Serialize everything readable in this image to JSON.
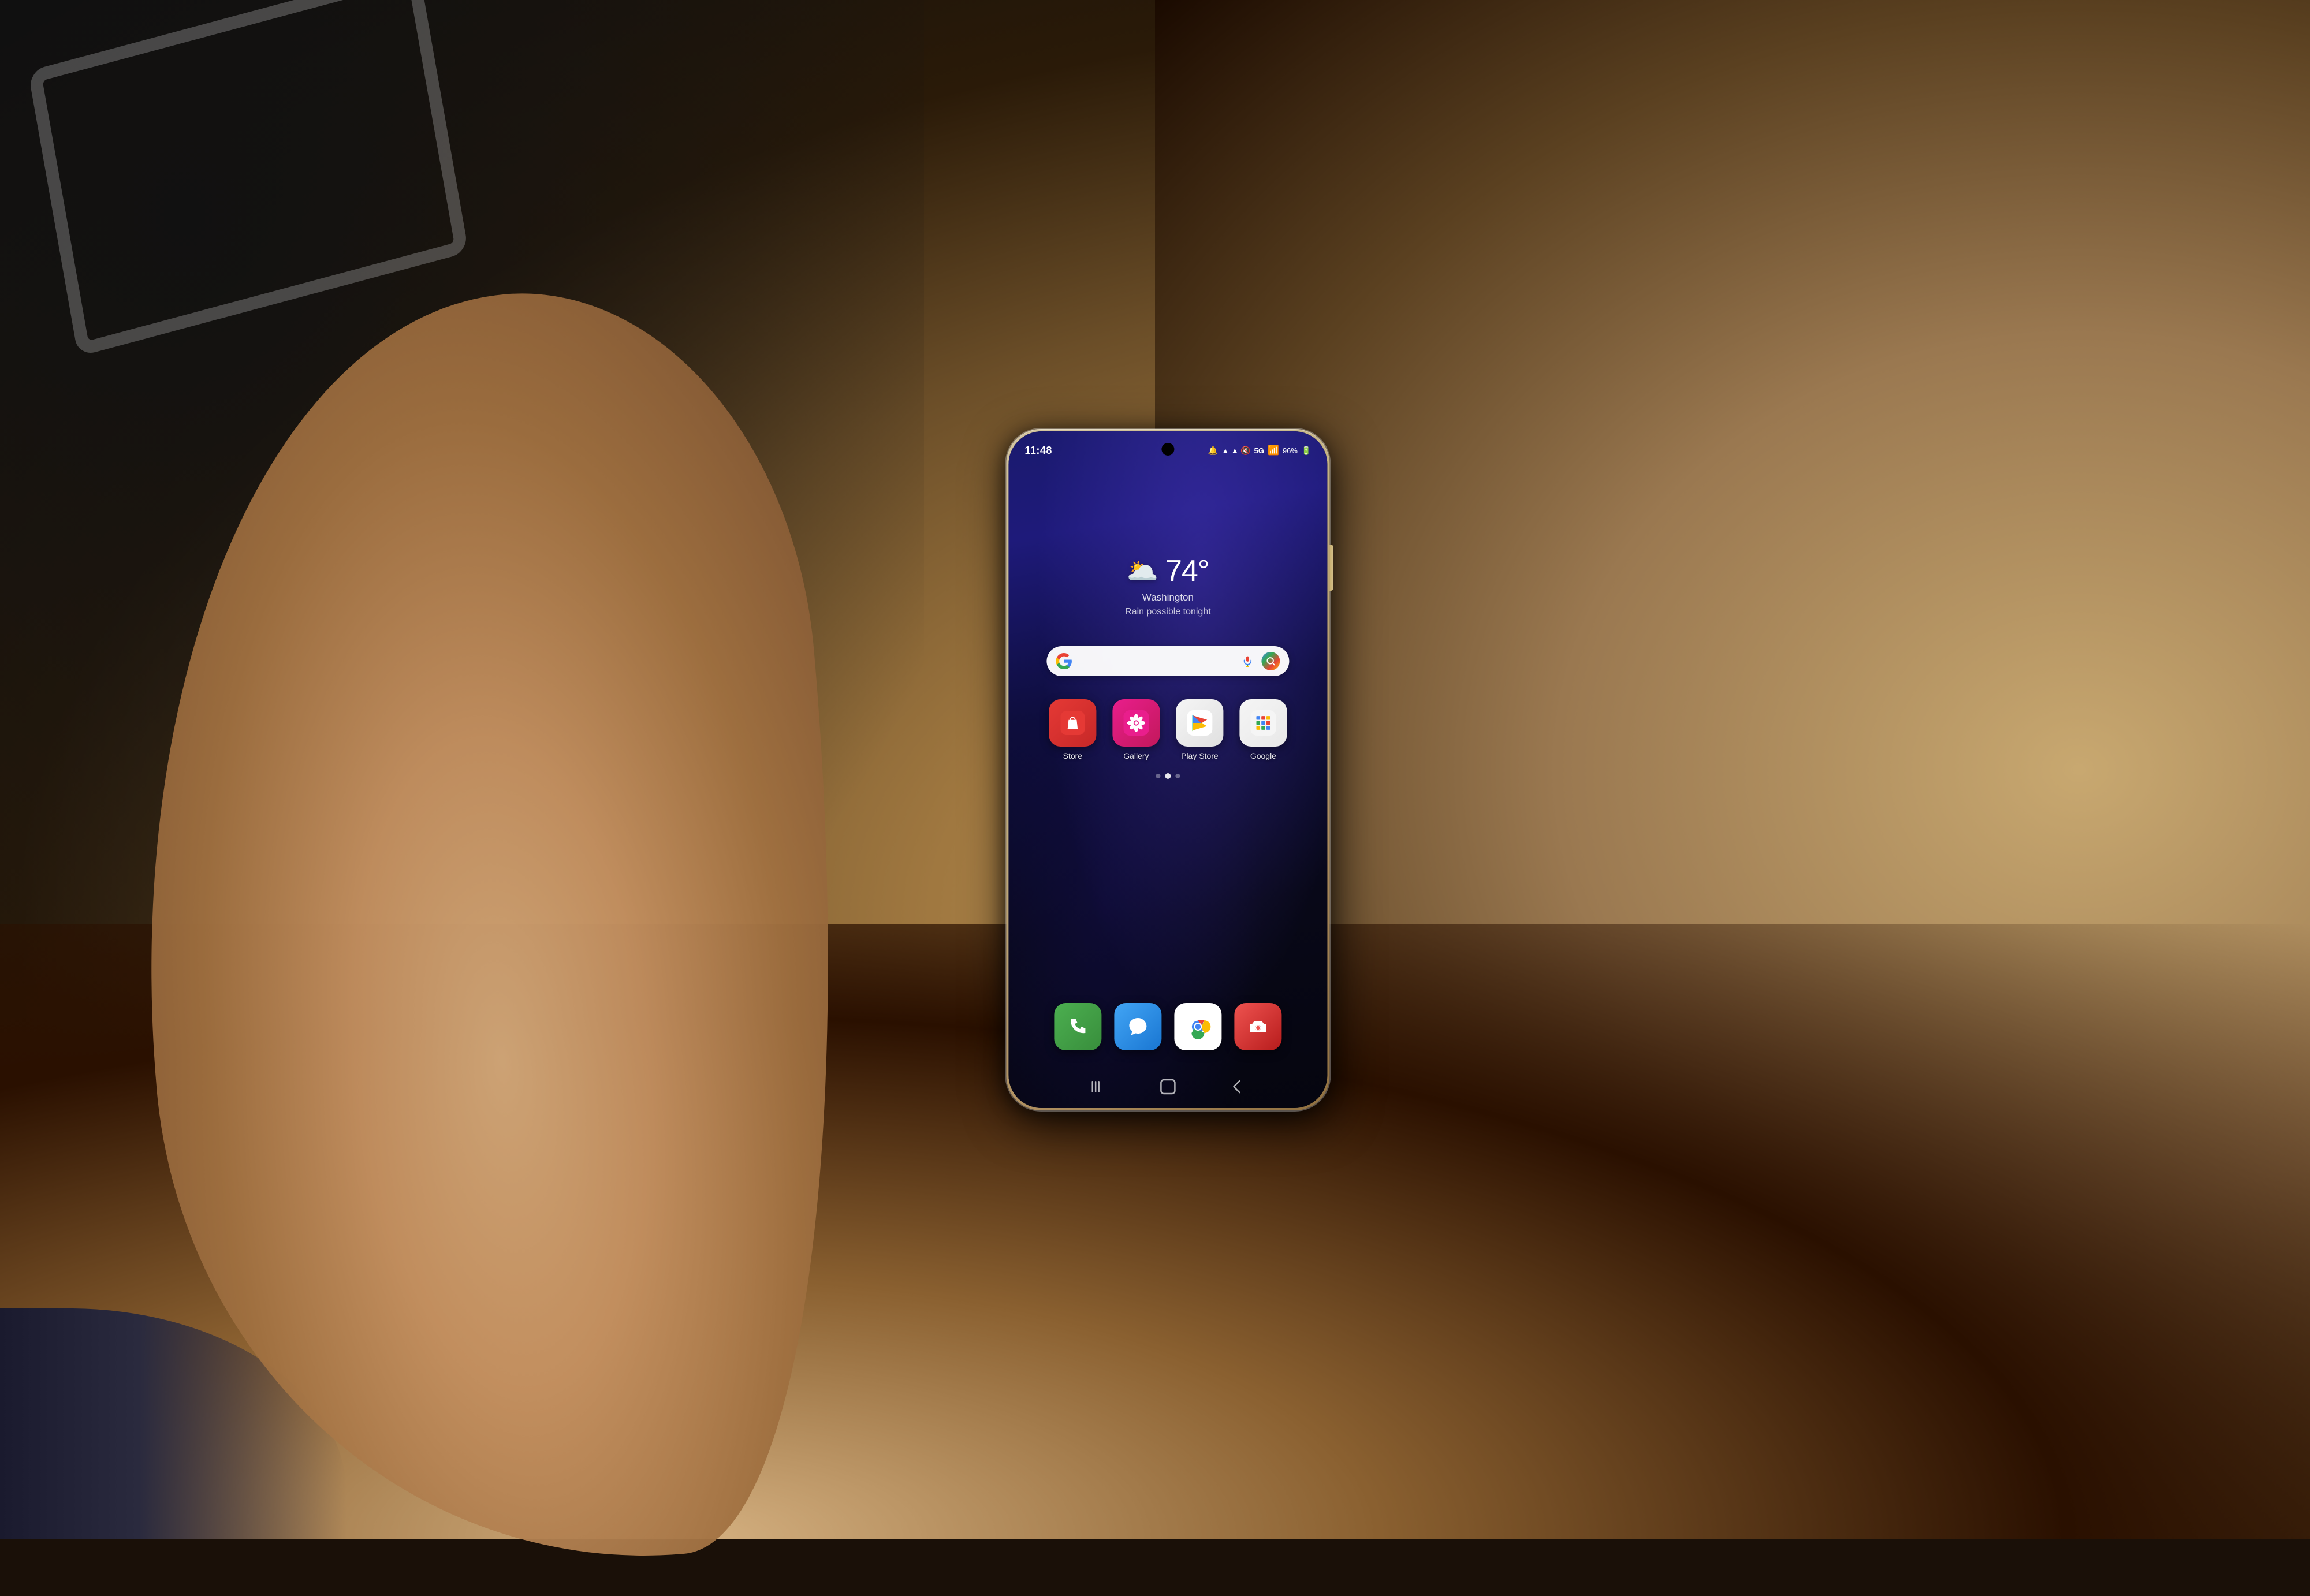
{
  "background": {
    "primary_color": "#1a1008",
    "accent_color": "#c8a96e"
  },
  "phone": {
    "frame_color": "#c8b880",
    "screen_bg_top": "#1a1a6e",
    "screen_bg_bottom": "#05050f"
  },
  "status_bar": {
    "time": "11:48",
    "icons": "🔔 ▲ ▴ 📶",
    "signal": "5G",
    "battery": "96%",
    "battery_icon": "🔋",
    "right_text": "5G↑ 96%"
  },
  "weather": {
    "icon": "🌥️",
    "temperature": "74°",
    "location": "Washington",
    "description": "Rain possible tonight"
  },
  "search_bar": {
    "placeholder": ""
  },
  "apps": [
    {
      "id": "store",
      "label": "Store",
      "bg": "#e53935",
      "icon": "🛍️"
    },
    {
      "id": "gallery",
      "label": "Gallery",
      "bg": "#e91e8c",
      "icon": "✿"
    },
    {
      "id": "play-store",
      "label": "Play Store",
      "bg": "#f5f5f5",
      "icon": "▶"
    },
    {
      "id": "google",
      "label": "Google",
      "bg": "#f5f5f5",
      "icon": "⊞"
    }
  ],
  "dock": [
    {
      "id": "phone",
      "bg": "#4caf50",
      "icon": "📞"
    },
    {
      "id": "messages",
      "bg": "#2196f3",
      "icon": "💬"
    },
    {
      "id": "chrome",
      "bg": "#f5f5f5",
      "icon": "⊙"
    },
    {
      "id": "camera",
      "bg": "#e53935",
      "icon": "📷"
    }
  ],
  "page_dots": [
    {
      "active": false
    },
    {
      "active": false
    },
    {
      "active": true
    },
    {
      "active": false
    }
  ],
  "nav_bar": {
    "back": "‹",
    "home": "⬜",
    "recents": "|||"
  }
}
